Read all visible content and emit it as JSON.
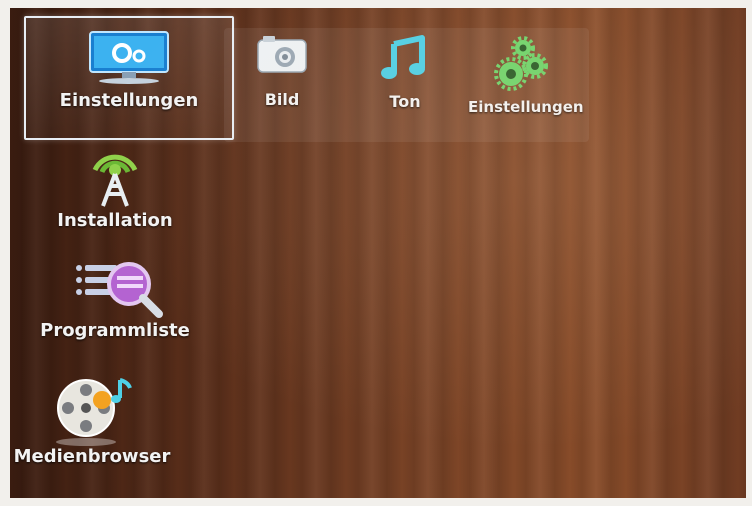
{
  "top_menu": {
    "selected": {
      "label": "Einstellungen",
      "icon": "monitor-settings-icon"
    },
    "items": [
      {
        "label": "Bild",
        "icon": "camera-icon"
      },
      {
        "label": "Ton",
        "icon": "music-note-icon"
      },
      {
        "label": "Einstellungen",
        "icon": "gears-icon"
      }
    ]
  },
  "side_menu": {
    "items": [
      {
        "label": "Installation",
        "icon": "antenna-tower-icon"
      },
      {
        "label": "Programmliste",
        "icon": "channel-list-search-icon"
      },
      {
        "label": "Medienbrowser",
        "icon": "media-reel-icon"
      }
    ]
  },
  "colors": {
    "accent": "#66ccff",
    "accent_green": "#8fd14a",
    "accent_purple": "#b463d1",
    "text": "#f3f3f3"
  }
}
